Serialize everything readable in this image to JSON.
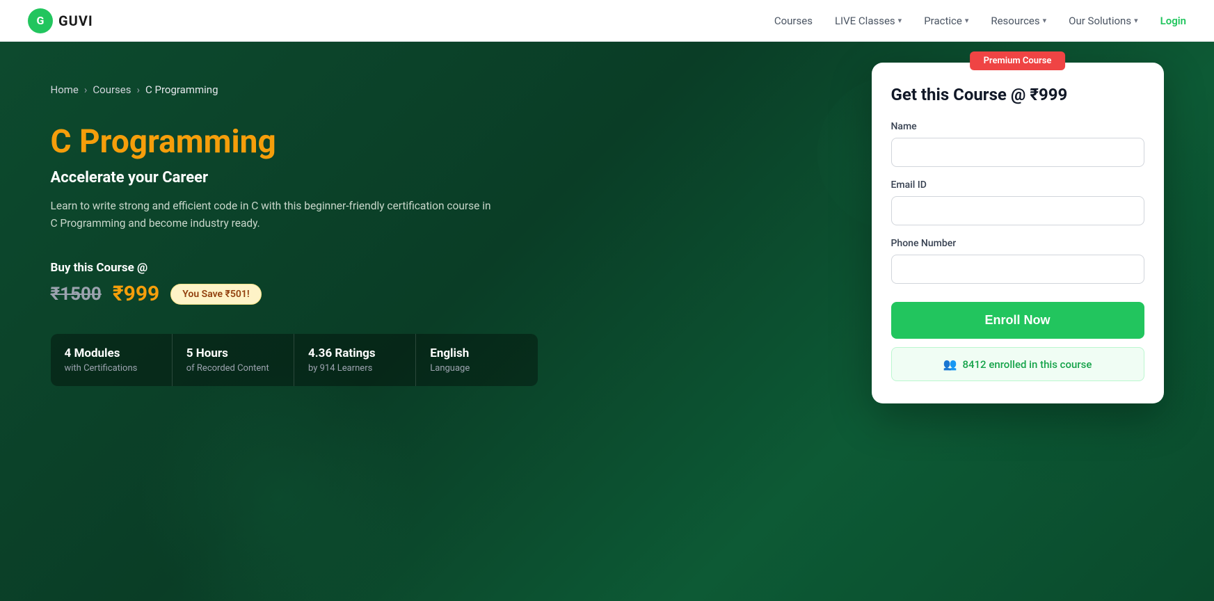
{
  "brand": {
    "logo_letter": "G",
    "name": "GUVI"
  },
  "navbar": {
    "links": [
      {
        "label": "Courses",
        "has_dropdown": false
      },
      {
        "label": "LIVE Classes",
        "has_dropdown": true
      },
      {
        "label": "Practice",
        "has_dropdown": true
      },
      {
        "label": "Resources",
        "has_dropdown": true
      },
      {
        "label": "Our Solutions",
        "has_dropdown": true
      }
    ],
    "login_label": "Login"
  },
  "breadcrumb": {
    "home": "Home",
    "courses": "Courses",
    "current": "C Programming"
  },
  "hero": {
    "course_title": "C Programming",
    "course_subtitle": "Accelerate your Career",
    "course_description": "Learn to write strong and efficient code in C with this beginner-friendly certification course in C Programming and become industry ready.",
    "pricing_label": "Buy this Course @",
    "price_original": "₹1500",
    "price_current": "₹999",
    "price_save": "You Save ₹501!",
    "stats": [
      {
        "main": "4 Modules",
        "sub": "with Certifications"
      },
      {
        "main": "5 Hours",
        "sub": "of Recorded Content"
      },
      {
        "main": "4.36 Ratings",
        "sub": "by 914 Learners"
      },
      {
        "main": "English",
        "sub": "Language"
      }
    ]
  },
  "enrollment_card": {
    "premium_badge": "Premium Course",
    "title": "Get this Course @ ₹999",
    "name_label": "Name",
    "name_placeholder": "",
    "email_label": "Email ID",
    "email_placeholder": "",
    "phone_label": "Phone Number",
    "phone_placeholder": "",
    "enroll_btn": "Enroll Now",
    "enrolled_text": "8412 enrolled in this course"
  }
}
